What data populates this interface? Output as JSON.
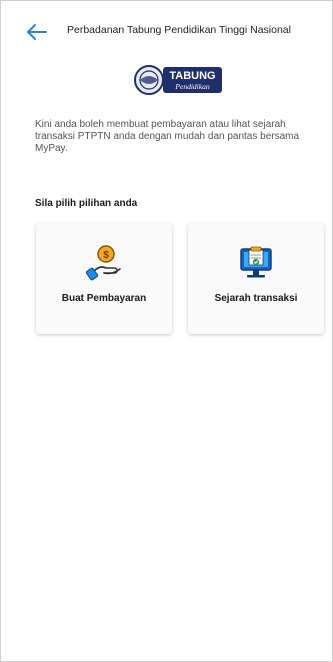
{
  "header": {
    "title": "Perbadanan Tabung Pendidikan Tinggi Nasional",
    "back_icon": "arrow-left-icon",
    "accent_color": "#1e88e5"
  },
  "logo": {
    "brand_text": "TABUNG",
    "brand_subtext": "Pendidikan",
    "brand_color": "#1f2f6b"
  },
  "main": {
    "intro_text": "Kini anda boleh membuat pembayaran atau lihat sejarah transaksi PTPTN anda dengan mudah dan pantas bersama MyPay.",
    "section_title": "Sila pilih pilihan anda",
    "options": [
      {
        "label": "Buat Pembayaran",
        "icon": "hand-coin-payment-icon"
      },
      {
        "label": "Sejarah transaksi",
        "icon": "monitor-history-icon"
      }
    ]
  }
}
